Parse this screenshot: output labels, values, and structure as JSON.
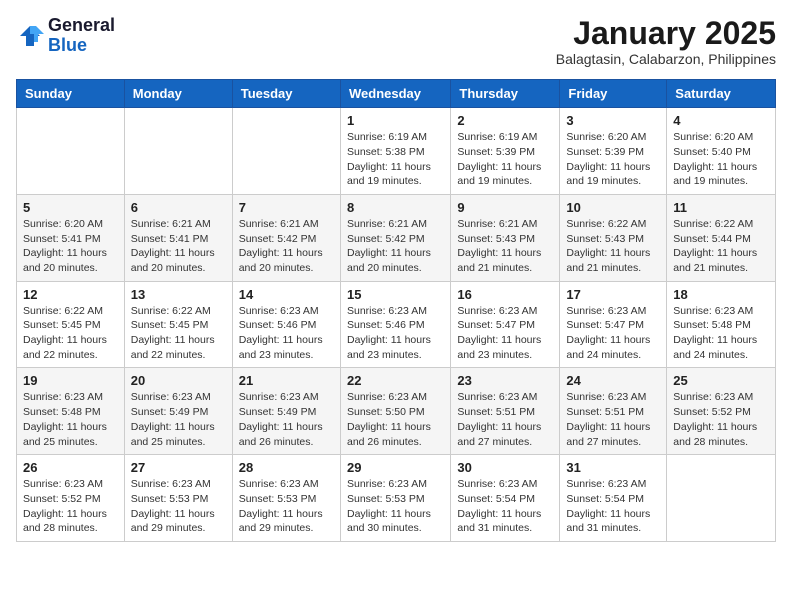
{
  "header": {
    "logo_general": "General",
    "logo_blue": "Blue",
    "month_title": "January 2025",
    "location": "Balagtasin, Calabarzon, Philippines"
  },
  "days_of_week": [
    "Sunday",
    "Monday",
    "Tuesday",
    "Wednesday",
    "Thursday",
    "Friday",
    "Saturday"
  ],
  "weeks": [
    [
      {
        "day": "",
        "info": ""
      },
      {
        "day": "",
        "info": ""
      },
      {
        "day": "",
        "info": ""
      },
      {
        "day": "1",
        "info": "Sunrise: 6:19 AM\nSunset: 5:38 PM\nDaylight: 11 hours and 19 minutes."
      },
      {
        "day": "2",
        "info": "Sunrise: 6:19 AM\nSunset: 5:39 PM\nDaylight: 11 hours and 19 minutes."
      },
      {
        "day": "3",
        "info": "Sunrise: 6:20 AM\nSunset: 5:39 PM\nDaylight: 11 hours and 19 minutes."
      },
      {
        "day": "4",
        "info": "Sunrise: 6:20 AM\nSunset: 5:40 PM\nDaylight: 11 hours and 19 minutes."
      }
    ],
    [
      {
        "day": "5",
        "info": "Sunrise: 6:20 AM\nSunset: 5:41 PM\nDaylight: 11 hours and 20 minutes."
      },
      {
        "day": "6",
        "info": "Sunrise: 6:21 AM\nSunset: 5:41 PM\nDaylight: 11 hours and 20 minutes."
      },
      {
        "day": "7",
        "info": "Sunrise: 6:21 AM\nSunset: 5:42 PM\nDaylight: 11 hours and 20 minutes."
      },
      {
        "day": "8",
        "info": "Sunrise: 6:21 AM\nSunset: 5:42 PM\nDaylight: 11 hours and 20 minutes."
      },
      {
        "day": "9",
        "info": "Sunrise: 6:21 AM\nSunset: 5:43 PM\nDaylight: 11 hours and 21 minutes."
      },
      {
        "day": "10",
        "info": "Sunrise: 6:22 AM\nSunset: 5:43 PM\nDaylight: 11 hours and 21 minutes."
      },
      {
        "day": "11",
        "info": "Sunrise: 6:22 AM\nSunset: 5:44 PM\nDaylight: 11 hours and 21 minutes."
      }
    ],
    [
      {
        "day": "12",
        "info": "Sunrise: 6:22 AM\nSunset: 5:45 PM\nDaylight: 11 hours and 22 minutes."
      },
      {
        "day": "13",
        "info": "Sunrise: 6:22 AM\nSunset: 5:45 PM\nDaylight: 11 hours and 22 minutes."
      },
      {
        "day": "14",
        "info": "Sunrise: 6:23 AM\nSunset: 5:46 PM\nDaylight: 11 hours and 23 minutes."
      },
      {
        "day": "15",
        "info": "Sunrise: 6:23 AM\nSunset: 5:46 PM\nDaylight: 11 hours and 23 minutes."
      },
      {
        "day": "16",
        "info": "Sunrise: 6:23 AM\nSunset: 5:47 PM\nDaylight: 11 hours and 23 minutes."
      },
      {
        "day": "17",
        "info": "Sunrise: 6:23 AM\nSunset: 5:47 PM\nDaylight: 11 hours and 24 minutes."
      },
      {
        "day": "18",
        "info": "Sunrise: 6:23 AM\nSunset: 5:48 PM\nDaylight: 11 hours and 24 minutes."
      }
    ],
    [
      {
        "day": "19",
        "info": "Sunrise: 6:23 AM\nSunset: 5:48 PM\nDaylight: 11 hours and 25 minutes."
      },
      {
        "day": "20",
        "info": "Sunrise: 6:23 AM\nSunset: 5:49 PM\nDaylight: 11 hours and 25 minutes."
      },
      {
        "day": "21",
        "info": "Sunrise: 6:23 AM\nSunset: 5:49 PM\nDaylight: 11 hours and 26 minutes."
      },
      {
        "day": "22",
        "info": "Sunrise: 6:23 AM\nSunset: 5:50 PM\nDaylight: 11 hours and 26 minutes."
      },
      {
        "day": "23",
        "info": "Sunrise: 6:23 AM\nSunset: 5:51 PM\nDaylight: 11 hours and 27 minutes."
      },
      {
        "day": "24",
        "info": "Sunrise: 6:23 AM\nSunset: 5:51 PM\nDaylight: 11 hours and 27 minutes."
      },
      {
        "day": "25",
        "info": "Sunrise: 6:23 AM\nSunset: 5:52 PM\nDaylight: 11 hours and 28 minutes."
      }
    ],
    [
      {
        "day": "26",
        "info": "Sunrise: 6:23 AM\nSunset: 5:52 PM\nDaylight: 11 hours and 28 minutes."
      },
      {
        "day": "27",
        "info": "Sunrise: 6:23 AM\nSunset: 5:53 PM\nDaylight: 11 hours and 29 minutes."
      },
      {
        "day": "28",
        "info": "Sunrise: 6:23 AM\nSunset: 5:53 PM\nDaylight: 11 hours and 29 minutes."
      },
      {
        "day": "29",
        "info": "Sunrise: 6:23 AM\nSunset: 5:53 PM\nDaylight: 11 hours and 30 minutes."
      },
      {
        "day": "30",
        "info": "Sunrise: 6:23 AM\nSunset: 5:54 PM\nDaylight: 11 hours and 31 minutes."
      },
      {
        "day": "31",
        "info": "Sunrise: 6:23 AM\nSunset: 5:54 PM\nDaylight: 11 hours and 31 minutes."
      },
      {
        "day": "",
        "info": ""
      }
    ]
  ]
}
